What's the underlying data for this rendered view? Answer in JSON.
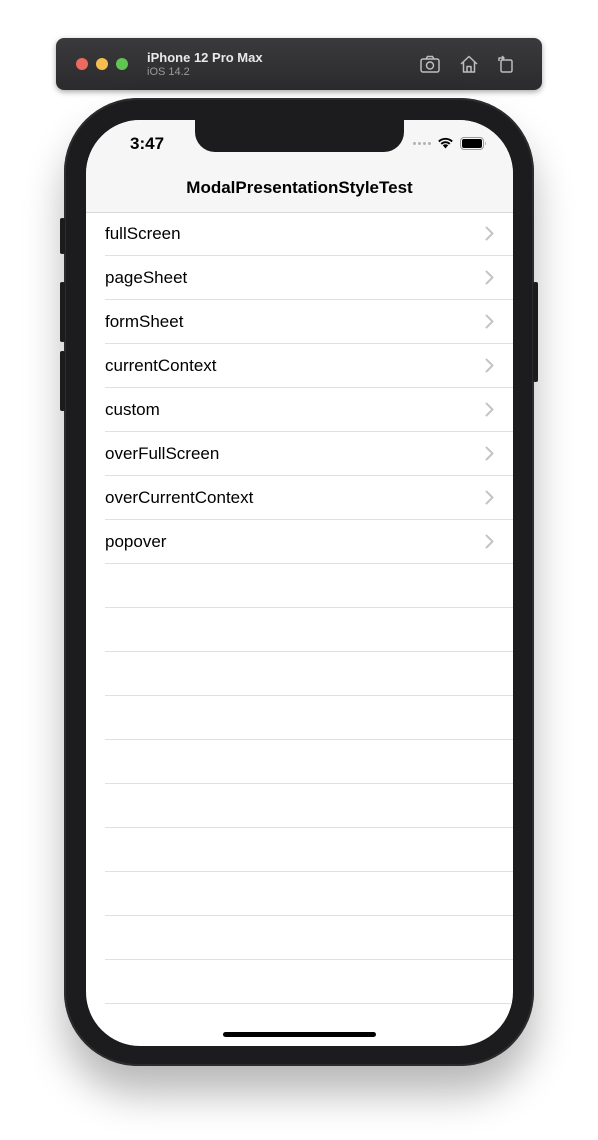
{
  "simulator": {
    "device_name": "iPhone 12 Pro Max",
    "os_version": "iOS 14.2",
    "icons": [
      "screenshot-icon",
      "home-icon",
      "rotate-icon"
    ]
  },
  "status_bar": {
    "time": "3:47"
  },
  "nav": {
    "title": "ModalPresentationStyleTest"
  },
  "list": {
    "items": [
      {
        "label": "fullScreen"
      },
      {
        "label": "pageSheet"
      },
      {
        "label": "formSheet"
      },
      {
        "label": "currentContext"
      },
      {
        "label": "custom"
      },
      {
        "label": "overFullScreen"
      },
      {
        "label": "overCurrentContext"
      },
      {
        "label": "popover"
      }
    ],
    "empty_rows": 10
  },
  "colors": {
    "nav_background": "#f6f6f6",
    "separator": "#e0e0e2",
    "chevron": "#c4c4c7",
    "phone_frame": "#1c1c1e"
  }
}
